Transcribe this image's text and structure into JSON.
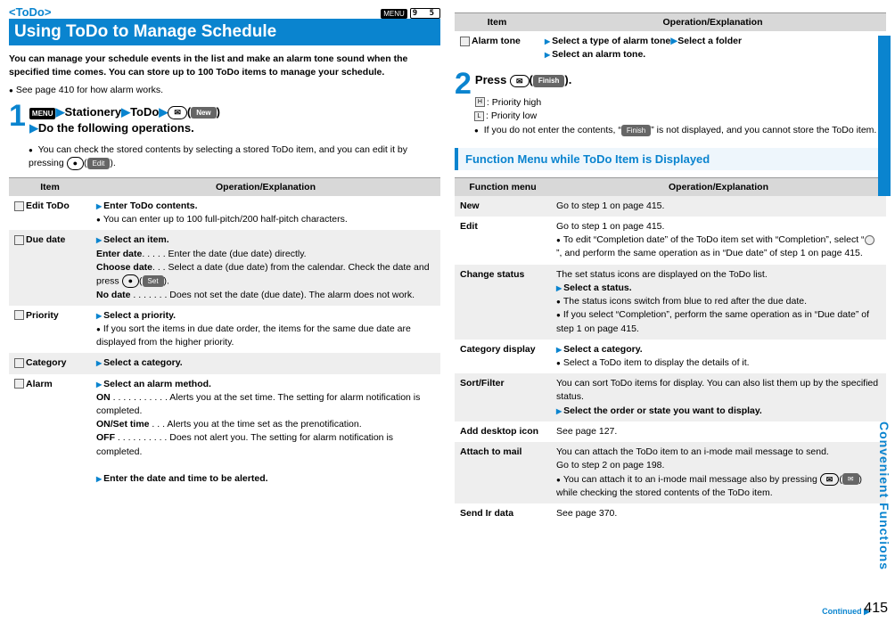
{
  "header": {
    "tag": "<ToDo>",
    "menu_key": "MENU",
    "menu_code": "9 5",
    "title": "Using ToDo to Manage Schedule"
  },
  "intro": "You can manage your schedule events in the list and make an alarm tone sound when the specified time comes. You can store up to 100 ToDo items to manage your schedule.",
  "intro_note": "See page 410 for how alarm works.",
  "step1": {
    "num": "1",
    "menu": "MENU",
    "path1": "Stationery",
    "path2": "ToDo",
    "mail_icon": "✉",
    "btn": "New",
    "line2": "Do the following operations.",
    "note": "You can check the stored contents by selecting a stored ToDo item, and you can edit it by pressing ",
    "note_btn": "Edit"
  },
  "table_head": {
    "c1": "Item",
    "c2": "Operation/Explanation"
  },
  "rows": {
    "edit": {
      "label": "Edit ToDo",
      "b1": "Enter ToDo contents.",
      "b2": "You can enter up to 100 full-pitch/200 half-pitch characters."
    },
    "due": {
      "label": "Due date",
      "b1": "Select an item.",
      "l1a": "Enter date",
      "l1b": ". . . . .  Enter the date (due date) directly.",
      "l2a": "Choose date",
      "l2b": ". . .  Select a date (due date) from the calendar. Check the date and press ",
      "l2btn": "Set",
      "l3a": "No date",
      "l3b": " . . . . . . .  Does not set the date (due date). The alarm does not work."
    },
    "priority": {
      "label": "Priority",
      "b1": "Select a priority.",
      "b2": "If you sort the items in due date order, the items for the same due date are displayed from the higher priority."
    },
    "category": {
      "label": "Category",
      "b1": "Select a category."
    },
    "alarm": {
      "label": "Alarm",
      "b1": "Select an alarm method.",
      "l1a": "ON",
      "l1b": " . . . . . . . . . . .  Alerts you at the set time. The setting for alarm notification is completed.",
      "l2a": "ON/Set time",
      "l2b": "  . . .  Alerts you at the time set as the prenotification.",
      "l3a": "OFF",
      "l3b": " . . . . . . . . . .  Does not alert you. The setting for alarm notification is completed.",
      "b2": "Enter the date and time to be alerted."
    }
  },
  "right_top": {
    "c1": "Item",
    "c2": "Operation/Explanation",
    "row_label": "Alarm tone",
    "r1": "Select a type of alarm tone",
    "r2": "Select a folder",
    "r3": "Select an alarm tone."
  },
  "step2": {
    "num": "2",
    "text": "Press ",
    "mail_icon": "✉",
    "btn": "Finish",
    "ph": "H",
    "ph_txt": ": Priority high",
    "pl": "L",
    "pl_txt": ": Priority low",
    "note1": "If you do not enter the contents, “",
    "note_btn": "Finish",
    "note2": "” is not displayed, and you cannot store the ToDo item."
  },
  "section": "Function Menu while ToDo Item is Displayed",
  "fm_head": {
    "c1": "Function menu",
    "c2": "Operation/Explanation"
  },
  "fm": {
    "newrow": {
      "l": "New",
      "t": "Go to step 1 on page 415."
    },
    "edit": {
      "l": "Edit",
      "t1": "Go to step 1 on page 415.",
      "t2a": "To edit “Completion date” of the ToDo item set with “Completion”, select “",
      "t2b": "”, and perform the same operation as in “Due date” of step 1 on page 415."
    },
    "status": {
      "l": "Change status",
      "t1": "The set status icons are displayed on the ToDo list.",
      "t2": "Select a status.",
      "t3": "The status icons switch from blue to red after the due date.",
      "t4": "If you select “Completion”, perform the same operation as in “Due date” of step 1 on page 415."
    },
    "cat": {
      "l": "Category display",
      "t1": "Select a category.",
      "t2": "Select a ToDo item to display the details of it."
    },
    "sort": {
      "l": "Sort/Filter",
      "t1": "You can sort ToDo items for display. You can also list them up by the specified status.",
      "t2": "Select the order or state you want to display."
    },
    "add": {
      "l": "Add desktop icon",
      "t": "See page 127."
    },
    "attach": {
      "l": "Attach to mail",
      "t1": "You can attach the ToDo item to an i-mode mail message to send.",
      "t2": "Go to step 2 on page 198.",
      "t3a": "You can attach it to an i-mode mail message also by pressing ",
      "t3b": " while checking the stored contents of the ToDo item.",
      "mail_btn": "✉"
    },
    "ir": {
      "l": "Send Ir data",
      "t": "See page 370."
    }
  },
  "side": "Convenient Functions",
  "cont": "Continued ▶",
  "pagenum": "415"
}
